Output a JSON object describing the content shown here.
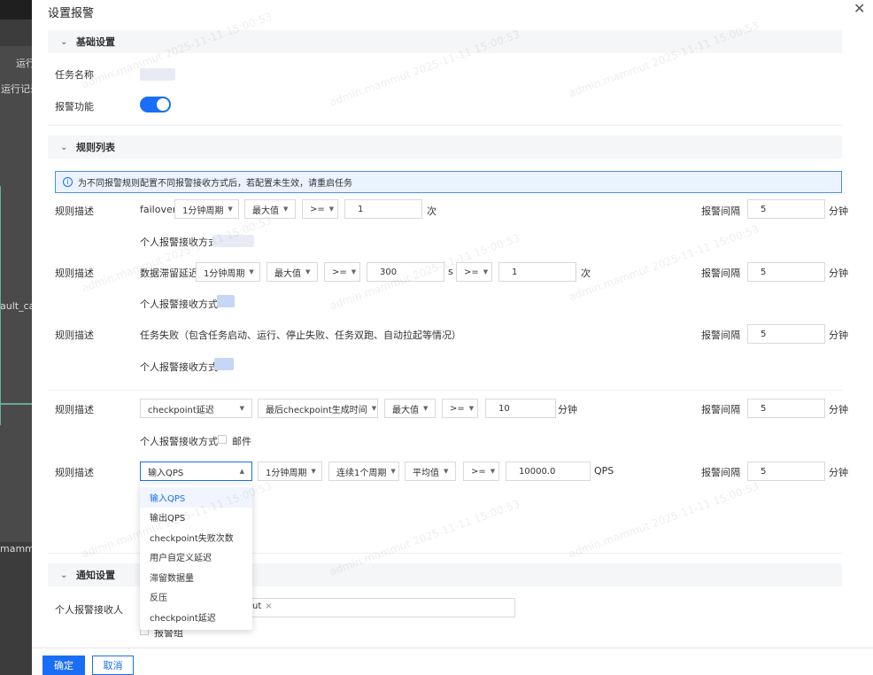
{
  "background_app": {
    "labels": [
      "运行",
      "运行记录",
      "ault_cat",
      "mammu"
    ]
  },
  "drawer": {
    "title": "设置报警",
    "close_icon": "close-icon"
  },
  "basic": {
    "section_title": "基础设置",
    "task_name_label": "任务名称",
    "alert_label": "报警功能",
    "alert_enabled": true
  },
  "rules": {
    "section_title": "规则列表",
    "info_text": "为不同报警规则配置不同报警接收方式后，若配置未生效，请重启任务",
    "desc_label": "规则描述",
    "interval_label": "报警间隔",
    "interval_unit": "分钟",
    "receive_label": "个人报警接收方式",
    "rule1": {
      "metric": "failover",
      "period": "1分钟周期",
      "agg": "最大值",
      "op": ">=",
      "value": "1",
      "unit": "次",
      "interval": "5"
    },
    "rule2": {
      "metric": "数据滞留延迟",
      "period": "1分钟周期",
      "agg": "最大值",
      "op": ">=",
      "value": "300",
      "value_unit": "s",
      "op2": ">=",
      "value2": "1",
      "unit": "次",
      "interval": "5"
    },
    "rule3": {
      "metric": "任务失败（包含任务启动、运行、停止失败、任务双跑、自动拉起等情况）",
      "interval": "5"
    },
    "rule4": {
      "metric": "checkpoint延迟",
      "sub": "最后checkpoint生成时间",
      "agg": "最大值",
      "op": ">=",
      "value": "10",
      "unit": "分钟",
      "interval": "5",
      "email_label": "邮件"
    },
    "rule5": {
      "metric": "输入QPS",
      "period": "1分钟周期",
      "cycles": "连续1个周期",
      "agg": "平均值",
      "op": ">=",
      "value": "10000.0",
      "unit": "QPS",
      "interval": "5"
    },
    "dropdown_options": [
      "输入QPS",
      "输出QPS",
      "checkpoint失败次数",
      "用户自定义延迟",
      "滞留数据量",
      "反压",
      "checkpoint延迟"
    ],
    "dropdown_selected": "输入QPS"
  },
  "notify": {
    "section_title": "通知设置",
    "receiver_label": "个人报警接收人",
    "tag_suffix": "ut",
    "alarm_group_label": "报警组"
  },
  "footer": {
    "ok_label": "确定",
    "cancel_label": "取消"
  },
  "watermark": "admin.mammut 2025-11-11 15:00:53",
  "colors": {
    "primary": "#1a6ef5",
    "info_bg": "#eaf3ff"
  }
}
